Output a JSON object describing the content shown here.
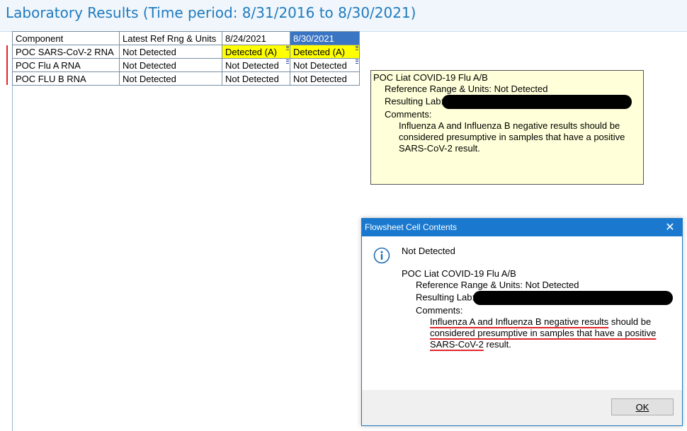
{
  "window": {
    "title": "Laboratory Results (Time period: 8/31/2016 to 8/30/2021)"
  },
  "grid": {
    "headers": [
      "Component",
      "Latest Ref Rng & Units",
      "8/24/2021",
      "8/30/2021"
    ],
    "selected_column": "8/30/2021",
    "rows": [
      {
        "component": "POC SARS-CoV-2 RNA",
        "ref": "Not Detected",
        "d1": "Detected (A)",
        "d2": "Detected (A)",
        "abnormal": true
      },
      {
        "component": "POC Flu A RNA",
        "ref": "Not Detected",
        "d1": "Not Detected",
        "d2": "Not Detected",
        "abnormal": false
      },
      {
        "component": "POC FLU B RNA",
        "ref": "Not Detected",
        "d1": "Not Detected",
        "d2": "Not Detected",
        "abnormal": false
      }
    ],
    "colors": {
      "abnormal_highlight": "#ffff00",
      "selected_header": "#3a75c4"
    }
  },
  "tooltip": {
    "test_name": "POC Liat COVID-19 Flu A/B",
    "reference_range": "Reference Range & Units: Not Detected",
    "resulting_lab_label": "Resulting Lab:",
    "comments_label": "Comments:",
    "comment_lines": [
      "Influenza A and Influenza B negative results should be",
      "considered presumptive in samples that have a positive",
      "SARS-CoV-2 result."
    ]
  },
  "dialog": {
    "title": "Flowsheet Cell Contents",
    "icon": "info-icon",
    "result": "Not Detected",
    "test_name": "POC Liat COVID-19 Flu A/B",
    "reference_range": "Reference Range & Units: Not Detected",
    "resulting_lab_label": "Resulting Lab:",
    "comments_label": "Comments:",
    "comment_line1_ul": "Influenza A and Influenza B negative results",
    "comment_line1_rest": " should be",
    "comment_line2_ul": "considered presumptive in samples that have a positive",
    "comment_line3_ul": "SARS-CoV-2",
    "comment_line3_rest": " result.",
    "ok_label": "OK",
    "close_glyph": "✕"
  }
}
